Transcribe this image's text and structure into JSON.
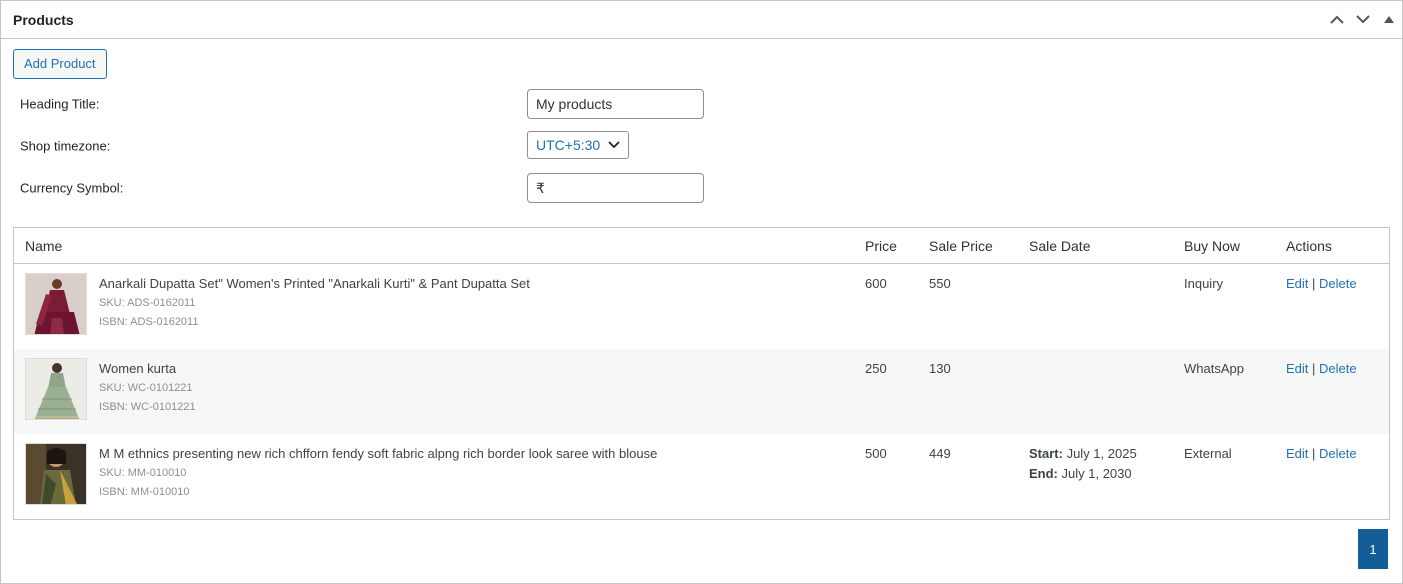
{
  "box": {
    "title": "Products"
  },
  "add_button_label": "Add Product",
  "form": {
    "heading_title_label": "Heading Title:",
    "heading_title_value": "My products",
    "timezone_label": "Shop timezone:",
    "timezone_value": "UTC+5:30",
    "currency_label": "Currency Symbol:",
    "currency_value": "₹"
  },
  "table": {
    "columns": [
      "Name",
      "Price",
      "Sale Price",
      "Sale Date",
      "Buy Now",
      "Actions"
    ],
    "rows": [
      {
        "name": "Anarkali Dupatta Set\" Women's Printed \"Anarkali Kurti\" & Pant Dupatta Set",
        "sku": "SKU: ADS-0162011",
        "isbn": "ISBN: ADS-0162011",
        "price": "600",
        "sale_price": "550",
        "sale_start": "",
        "sale_end": "",
        "buy_now": "Inquiry",
        "edit": "Edit",
        "delete": "Delete"
      },
      {
        "name": "Women kurta",
        "sku": "SKU: WC-0101221",
        "isbn": "ISBN: WC-0101221",
        "price": "250",
        "sale_price": "130",
        "sale_start": "",
        "sale_end": "",
        "buy_now": "WhatsApp",
        "edit": "Edit",
        "delete": "Delete"
      },
      {
        "name": "M M ethnics presenting new rich chfforn fendy soft fabric alpng rich border look saree with blouse",
        "sku": "SKU: MM-010010",
        "isbn": "ISBN: MM-010010",
        "price": "500",
        "sale_price": "449",
        "sale_start_label": "Start:",
        "sale_start": "July 1, 2025",
        "sale_end_label": "End:",
        "sale_end": "July 1, 2030",
        "buy_now": "External",
        "edit": "Edit",
        "delete": "Delete"
      }
    ],
    "separator": "|"
  },
  "pagination": {
    "current": "1"
  },
  "colors": {
    "accent": "#2271b1",
    "page_active": "#135e96",
    "border": "#c3c4c7"
  }
}
